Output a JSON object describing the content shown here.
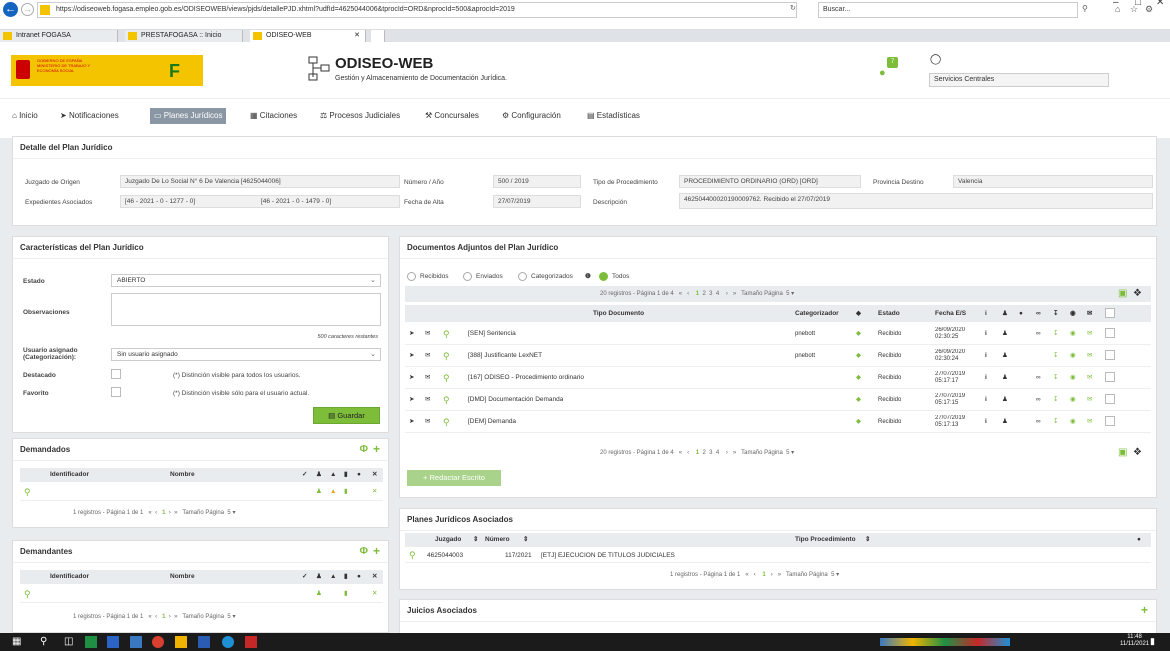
{
  "browser": {
    "url": "https://odiseoweb.fogasa.empleo.gob.es/ODISEOWEB/views/pjds/detallePJD.xhtml?udfId=4625044006&tprocId=ORD&nprocId=500&aprocId=2019",
    "search_placeholder": "Buscar...",
    "tabs": [
      {
        "label": "Intranet FOGASA"
      },
      {
        "label": "PRESTAFOGASA :: Inicio"
      },
      {
        "label": "ODISEO-WEB"
      }
    ]
  },
  "header": {
    "gov_text": "GOBIERNO DE ESPAÑA   MINISTERIO DE TRABAJO Y ECONOMÍA SOCIAL",
    "app_title": "ODISEO-WEB",
    "app_subtitle": "Gestión y Almacenamiento de Documentación Jurídica.",
    "notif_count": "7",
    "user_unit": "Servicios Centrales"
  },
  "nav": [
    {
      "label": "Inicio",
      "icon": "home-icon"
    },
    {
      "label": "Notificaciones",
      "icon": "signin-icon"
    },
    {
      "label": "Planes Jurídicos",
      "icon": "folder-icon"
    },
    {
      "label": "Citaciones",
      "icon": "calendar-icon"
    },
    {
      "label": "Procesos Judiciales",
      "icon": "scales-icon"
    },
    {
      "label": "Concursales",
      "icon": "gavel-icon"
    },
    {
      "label": "Configuración",
      "icon": "gear-icon"
    },
    {
      "label": "Estadísticas",
      "icon": "bar-chart-icon"
    }
  ],
  "detalle": {
    "title": "Detalle del Plan Jurídico",
    "juzgado_label": "Juzgado de Origen",
    "juzgado_value": "Juzgado De Lo Social N° 6 De Valencia [4625044006]",
    "numero_label": "Número / Año",
    "numero_value": "500 / 2019",
    "tipo_label": "Tipo de Procedimiento",
    "tipo_value": "PROCEDIMIENTO ORDINARIO (ORD) [ORD]",
    "provincia_label": "Provincia Destino",
    "provincia_value": "Valencia",
    "expedientes_label": "Expedientes Asociados",
    "expediente1": "[46 - 2021 - 0 - 1277 - 0]",
    "expediente2": "[46 - 2021 - 0 - 1479 - 0]",
    "fecha_label": "Fecha de Alta",
    "fecha_value": "27/07/2019",
    "descripcion_label": "Descripción",
    "descripcion_value": "462504400020190009762. Recibido el 27/07/2019"
  },
  "caracteristicas": {
    "title": "Características del Plan Jurídico",
    "estado_label": "Estado",
    "estado_value": "ABIERTO",
    "observaciones_label": "Observaciones",
    "restantes": "500 caracteres restantes",
    "usuario_label": "Usuario asignado (Categorización):",
    "usuario_value": "Sin usuario asignado",
    "destacado_label": "Destacado",
    "destacado_note": "(*) Distinción visible para todos los usuarios.",
    "favorito_label": "Favorito",
    "favorito_note": "(*) Distinción visible sólo para el usuario actual.",
    "guardar": "Guardar"
  },
  "demandados": {
    "title": "Demandados",
    "col_id": "Identificador",
    "col_nombre": "Nombre",
    "pager": "1 registros - Página 1 de 1",
    "page": "1",
    "size_label": "Tamaño Página",
    "size": "5"
  },
  "demandantes": {
    "title": "Demandantes",
    "col_id": "Identificador",
    "col_nombre": "Nombre",
    "pager": "1 registros - Página 1 de 1",
    "page": "1",
    "size_label": "Tamaño Página",
    "size": "5"
  },
  "documentos": {
    "title": "Documentos Adjuntos del Plan Jurídico",
    "filters": [
      "Recibidos",
      "Enviados",
      "Categorizados",
      "Todos"
    ],
    "pager": "20 registros - Página 1 de 4",
    "pages": [
      "1",
      "2",
      "3",
      "4"
    ],
    "size_label": "Tamaño Página",
    "size": "5",
    "col_tipo": "Tipo Documento",
    "col_cat": "Categorizador",
    "col_estado": "Estado",
    "col_fecha": "Fecha E/S",
    "rows": [
      {
        "tipo": "[SEN] Sentencia",
        "cat": "pnebott",
        "estado": "Recibido",
        "fecha": "26/09/2020",
        "hora": "02:30:25",
        "link": true
      },
      {
        "tipo": "[388] Justificante LexNET",
        "cat": "pnebott",
        "estado": "Recibido",
        "fecha": "26/09/2020",
        "hora": "02:30:24",
        "link": false
      },
      {
        "tipo": "[167] ODISEO - Procedimiento ordinario",
        "cat": "",
        "estado": "Recibido",
        "fecha": "27/07/2019",
        "hora": "05:17:17",
        "link": true
      },
      {
        "tipo": "[DMD] Documentación Demanda",
        "cat": "",
        "estado": "Recibido",
        "fecha": "27/07/2019",
        "hora": "05:17:15",
        "link": true
      },
      {
        "tipo": "[DEM] Demanda",
        "cat": "",
        "estado": "Recibido",
        "fecha": "27/07/2019",
        "hora": "05:17:13",
        "link": true
      }
    ],
    "redactar": "Redactar Escrito"
  },
  "planes": {
    "title": "Planes Jurídicos Asociados",
    "col_juzgado": "Juzgado",
    "col_numero": "Número",
    "col_tipo": "Tipo Procedimiento",
    "row": {
      "juzgado": "4625044003",
      "numero": "117/2021",
      "tipo": "[ETJ] EJECUCION DE TITULOS JUDICIALES"
    },
    "pager": "1 registros - Página 1 de 1",
    "page": "1",
    "size_label": "Tamaño Página",
    "size": "5"
  },
  "juicios": {
    "title": "Juicios Asociados"
  },
  "taskbar": {
    "time": "11:48",
    "date": "11/11/2021"
  },
  "colors": {
    "accent": "#7dbd3a",
    "nav_active": "#8a96a3",
    "brand_yellow": "#f5c400"
  }
}
